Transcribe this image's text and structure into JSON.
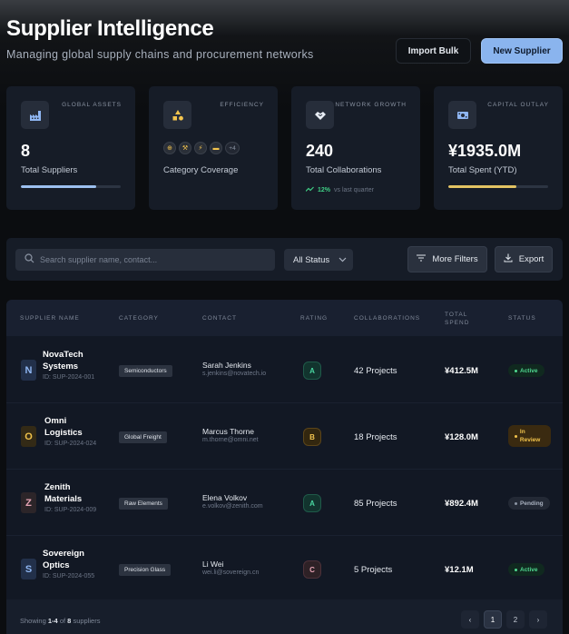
{
  "header": {
    "title": "Supplier Intelligence",
    "subtitle": "Managing global supply chains and procurement networks",
    "import_label": "Import Bulk",
    "new_label": "New Supplier"
  },
  "stats": {
    "assets": {
      "label": "GLOBAL ASSETS",
      "value": "8",
      "desc": "Total Suppliers",
      "icon": "factory-icon",
      "progress": 0.75,
      "bar_color": "#9cc0f0"
    },
    "efficiency": {
      "label": "EFFICIENCY",
      "desc": "Category Coverage",
      "icon": "shapes-icon",
      "chips": [
        "⊕",
        "⚒",
        "⚡",
        "▬"
      ],
      "more": "+4"
    },
    "growth": {
      "label": "NETWORK GROWTH",
      "value": "240",
      "desc": "Total Collaborations",
      "icon": "handshake-icon",
      "trend": "12%",
      "trend_text": "vs last quarter"
    },
    "capital": {
      "label": "CAPITAL OUTLAY",
      "value": "¥1935.0M",
      "desc": "Total Spent (YTD)",
      "icon": "cash-icon",
      "progress": 0.68,
      "bar_color": "#e3c363"
    }
  },
  "filters": {
    "search_placeholder": "Search supplier name, contact...",
    "status_value": "All Status",
    "more_filters_label": "More Filters",
    "export_label": "Export"
  },
  "table": {
    "columns": [
      "SUPPLIER NAME",
      "CATEGORY",
      "CONTACT",
      "RATING",
      "COLLABORATIONS",
      "TOTAL SPEND",
      "STATUS"
    ],
    "rows": [
      {
        "initial": "N",
        "initial_color": "#8fb6f2",
        "name": "NovaTech Systems",
        "id": "ID: SUP-2024-001",
        "category": "Semiconductors",
        "contact": "Sarah Jenkins",
        "email": "s.jenkins@novatech.io",
        "rating": "A",
        "collaborations": "42 Projects",
        "spend": "¥412.5M",
        "status": "Active"
      },
      {
        "initial": "O",
        "initial_color": "#f0c24b",
        "name": "Omni Logistics",
        "id": "ID: SUP-2024-024",
        "category": "Global Freight",
        "contact": "Marcus Thorne",
        "email": "m.thorne@omni.net",
        "rating": "B",
        "collaborations": "18 Projects",
        "spend": "¥128.0M",
        "status": "In Review"
      },
      {
        "initial": "Z",
        "initial_color": "#e6a3b4",
        "name": "Zenith Materials",
        "id": "ID: SUP-2024-009",
        "category": "Raw Elements",
        "contact": "Elena Volkov",
        "email": "e.volkov@zenith.com",
        "rating": "A",
        "collaborations": "85 Projects",
        "spend": "¥892.4M",
        "status": "Pending"
      },
      {
        "initial": "S",
        "initial_color": "#8fb6f2",
        "name": "Sovereign Optics",
        "id": "ID: SUP-2024-055",
        "category": "Precision Glass",
        "contact": "Li Wei",
        "email": "wei.li@sovereign.cn",
        "rating": "C",
        "collaborations": "5 Projects",
        "spend": "¥12.1M",
        "status": "Active"
      }
    ]
  },
  "footer": {
    "prefix": "Showing",
    "range": "1-4",
    "of": "of",
    "total": "8",
    "suffix": "suppliers",
    "prev": "‹",
    "pages": [
      "1",
      "2"
    ],
    "next": "›"
  },
  "colors": {
    "accent": "#8ab4ee",
    "positive": "#3fcf85",
    "warning": "#f0c24b"
  }
}
